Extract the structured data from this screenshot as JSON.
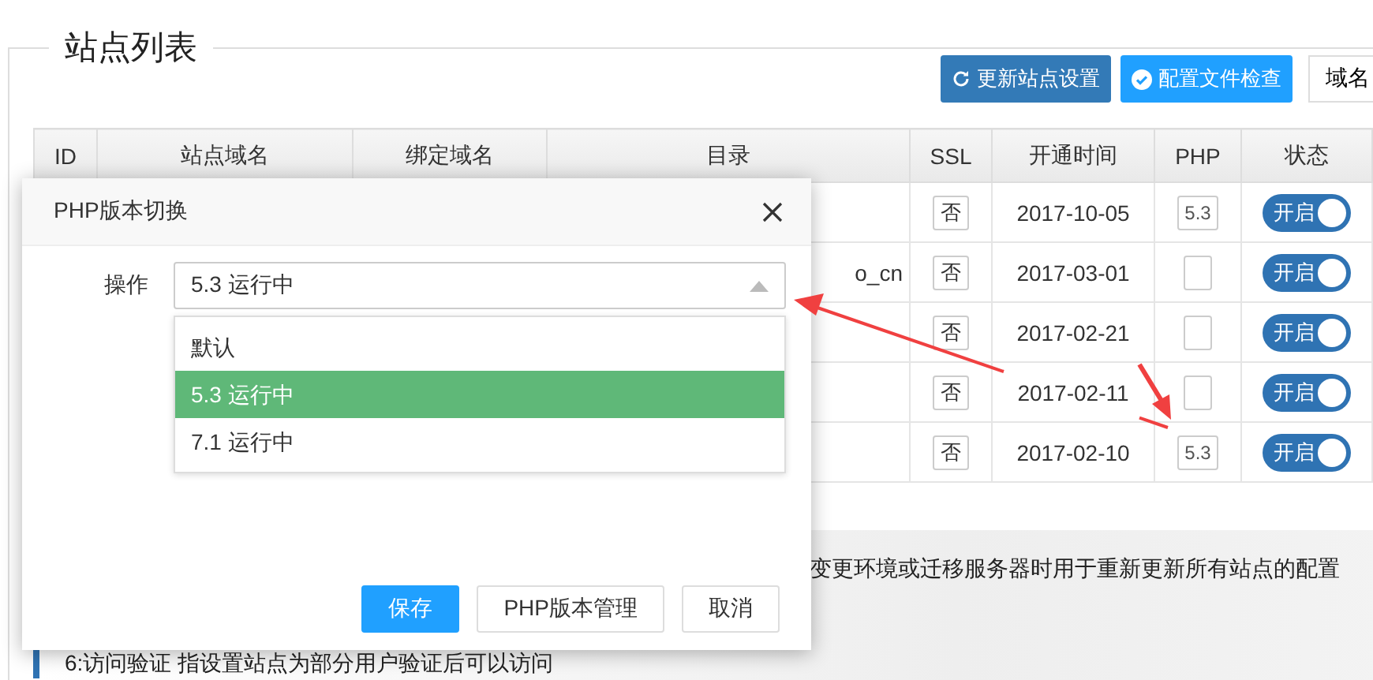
{
  "page_title": "站点列表",
  "toolbar": {
    "buttons": [
      {
        "label": "更新站点设置",
        "kind": "refresh"
      },
      {
        "label": "配置文件检查",
        "kind": "check"
      }
    ],
    "domain_select": "域名"
  },
  "table": {
    "columns": [
      "ID",
      "站点域名",
      "绑定域名",
      "目录",
      "SSL",
      "开通时间",
      "PHP",
      "状态"
    ],
    "rows": [
      {
        "ssl": "否",
        "created": "2017-10-05",
        "php": "5.3",
        "status": {
          "label": "开启",
          "on": true
        }
      },
      {
        "directory": "o_cn",
        "ssl": "否",
        "created": "2017-03-01",
        "status": {
          "label": "开启",
          "on": true
        }
      },
      {
        "ssl": "否",
        "created": "2017-02-21",
        "status": {
          "label": "开启",
          "on": true
        }
      },
      {
        "ssl": "否",
        "created": "2017-02-11",
        "status": {
          "label": "开启",
          "on": true
        }
      },
      {
        "ssl": "否",
        "created": "2017-02-10",
        "php": "5.3",
        "status": {
          "label": "开启",
          "on": true
        }
      }
    ]
  },
  "notes": [
    "变更环境或迁移服务器时用于重新更新所有站点的配置",
    "6:访问验证 指设置站点为部分用户验证后可以访问"
  ],
  "dialog": {
    "title": "PHP版本切换",
    "field_label": "操作",
    "select_value": "5.3 运行中",
    "options": [
      {
        "label": "默认",
        "selected": false
      },
      {
        "label": "5.3 运行中",
        "selected": true
      },
      {
        "label": "7.1 运行中",
        "selected": false
      }
    ],
    "buttons": [
      {
        "label": "保存",
        "kind": "primary"
      },
      {
        "label": "PHP版本管理",
        "kind": "default"
      },
      {
        "label": "取消",
        "kind": "default"
      }
    ]
  }
}
